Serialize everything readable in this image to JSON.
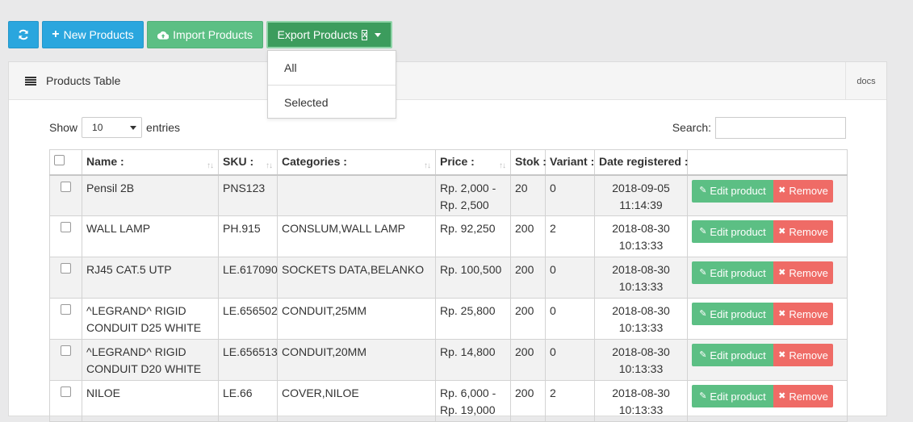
{
  "toolbar": {
    "refresh_icon": "refresh-icon",
    "new_label": "New Products",
    "import_label": "Import Products",
    "export_label": "Export Products",
    "colors": {
      "blue": "#2aa6de",
      "green": "#5cbf84",
      "dark_green": "#3c9c5d"
    }
  },
  "export_menu": {
    "items": [
      "All",
      "Selected"
    ]
  },
  "panel": {
    "title": "Products Table",
    "docs_label": "docs"
  },
  "controls": {
    "show_label": "Show",
    "entries_value": "10",
    "entries_label": "entries",
    "search_label": "Search:",
    "search_value": ""
  },
  "table": {
    "headers": [
      "Name :",
      "SKU :",
      "Categories :",
      "Price :",
      "Stok :",
      "Variant :",
      "Date registered :"
    ],
    "rows": [
      {
        "name": "Pensil 2B",
        "sku": "PNS123",
        "categories": "",
        "price": "Rp. 2,000 - Rp. 2,500",
        "stok": "20",
        "variant": "0",
        "date": "2018-09-05",
        "time": "11:14:39"
      },
      {
        "name": "WALL LAMP",
        "sku": "PH.915",
        "categories": "CONSLUM,WALL LAMP",
        "price": "Rp. 92,250",
        "stok": "200",
        "variant": "2",
        "date": "2018-08-30",
        "time": "10:13:33"
      },
      {
        "name": "RJ45 CAT.5 UTP",
        "sku": "LE.617090",
        "categories": "SOCKETS DATA,BELANKO",
        "price": "Rp. 100,500",
        "stok": "200",
        "variant": "0",
        "date": "2018-08-30",
        "time": "10:13:33"
      },
      {
        "name": "^LEGRAND^ RIGID CONDUIT D25 WHITE",
        "sku": "LE.656502",
        "categories": "CONDUIT,25MM",
        "price": "Rp. 25,800",
        "stok": "200",
        "variant": "0",
        "date": "2018-08-30",
        "time": "10:13:33"
      },
      {
        "name": "^LEGRAND^ RIGID CONDUIT D20 WHITE",
        "sku": "LE.656513",
        "categories": "CONDUIT,20MM",
        "price": "Rp. 14,800",
        "stok": "200",
        "variant": "0",
        "date": "2018-08-30",
        "time": "10:13:33"
      },
      {
        "name": "NILOE",
        "sku": "LE.66",
        "categories": "COVER,NILOE",
        "price": "Rp. 6,000 - Rp. 19,000",
        "stok": "200",
        "variant": "2",
        "date": "2018-08-30",
        "time": "10:13:33"
      }
    ],
    "edit_label": "Edit product",
    "remove_label": "Remove"
  }
}
